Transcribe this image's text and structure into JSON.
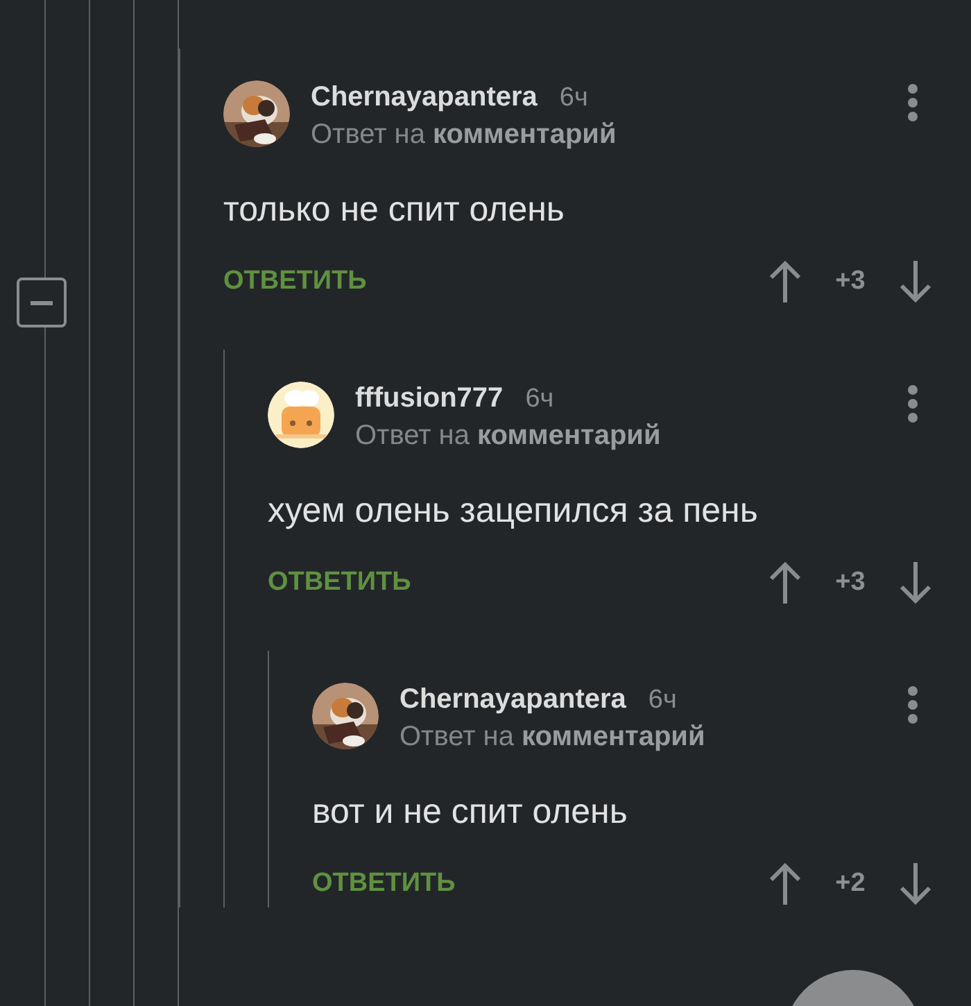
{
  "comments": [
    {
      "author": "Chernayapantera",
      "time": "6ч",
      "reply_info": "Ответ на **комментарий**",
      "text": "только не спит олень",
      "reply_label": "ОТВЕТИТЬ",
      "score": "+3",
      "children": [
        {
          "author": "fffusion777",
          "time": "6ч",
          "reply_info": "Ответ на **комментарий**",
          "text": "хуем олень зацепился за пень",
          "reply_label": "ОТВЕТИТЬ",
          "score": "+3",
          "children": [
            {
              "author": "Chernayapantera",
              "time": "6ч",
              "reply_info": "Ответ на **комментарий**",
              "text": "вот и не спит олень",
              "reply_label": "ОТВЕТИТЬ",
              "score": "+2"
            }
          ]
        }
      ]
    }
  ]
}
